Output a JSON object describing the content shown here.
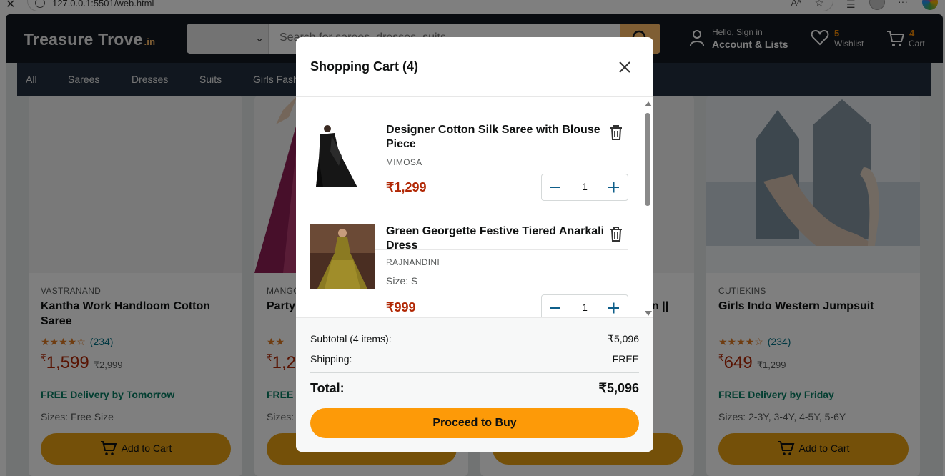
{
  "browser": {
    "url": "127.0.0.1:5501/web.html",
    "reader_label": "Aᴬ"
  },
  "site": {
    "logo_text": "Treasure Trove",
    "logo_suffix": ".in",
    "search_placeholder": "Search for sarees, dresses, suits...",
    "account_line1": "Hello, Sign in",
    "account_line2": "Account & Lists",
    "wishlist_count": "5",
    "wishlist_label": "Wishlist",
    "cart_count": "4",
    "cart_label": "Cart",
    "nav": [
      "All",
      "Sarees",
      "Dresses",
      "Suits",
      "Girls Fash"
    ]
  },
  "products": [
    {
      "brand": "VASTRANAND",
      "title": "Kantha Work Handloom Cotton Saree",
      "stars": "★★★★☆",
      "reviews": "(234)",
      "currency": "₹",
      "price": "1,599",
      "mrp": "₹2,999",
      "delivery": "FREE Delivery by Tomorrow",
      "sizes": "Sizes: Free Size",
      "add_label": "Add to Cart"
    },
    {
      "brand": "MANGO",
      "title": "Party",
      "stars": "★★",
      "reviews": "",
      "currency": "₹",
      "price": "1,2",
      "mrp": "",
      "delivery": "FREE",
      "sizes": "Sizes:",
      "add_label": ""
    },
    {
      "brand": "",
      "title": "n ||",
      "stars": "",
      "reviews": "",
      "currency": "",
      "price": "",
      "mrp": "",
      "delivery": "",
      "sizes": "",
      "add_label": ""
    },
    {
      "brand": "CUTIEKINS",
      "title": "Girls Indo Western Jumpsuit",
      "stars": "★★★★☆",
      "reviews": "(234)",
      "currency": "₹",
      "price": "649",
      "mrp": "₹1,299",
      "delivery": "FREE Delivery by Friday",
      "sizes": "Sizes: 2-3Y, 3-4Y, 4-5Y, 5-6Y",
      "add_label": "Add to Cart"
    }
  ],
  "cart": {
    "title": "Shopping Cart (4)",
    "items": [
      {
        "name": "Designer Cotton Silk Saree with Blouse Piece",
        "brand": "MIMOSA",
        "size": "",
        "price": "₹1,299",
        "qty": "1"
      },
      {
        "name": "Green Georgette Festive Tiered Anarkali Dress",
        "brand": "RAJNANDINI",
        "size": "Size: S",
        "price": "₹999",
        "qty": "1"
      }
    ],
    "subtotal_label": "Subtotal (4 items):",
    "subtotal_value": "₹5,096",
    "shipping_label": "Shipping:",
    "shipping_value": "FREE",
    "total_label": "Total:",
    "total_value": "₹5,096",
    "buy_label": "Proceed to Buy"
  },
  "colors": {
    "header_bg": "#131921",
    "nav_bg": "#232f3e",
    "accent": "#febd69",
    "buy_button": "#fd9a08",
    "price_red": "#b12704",
    "delivery_green": "#067d62",
    "qty_icon_blue": "#007185"
  }
}
